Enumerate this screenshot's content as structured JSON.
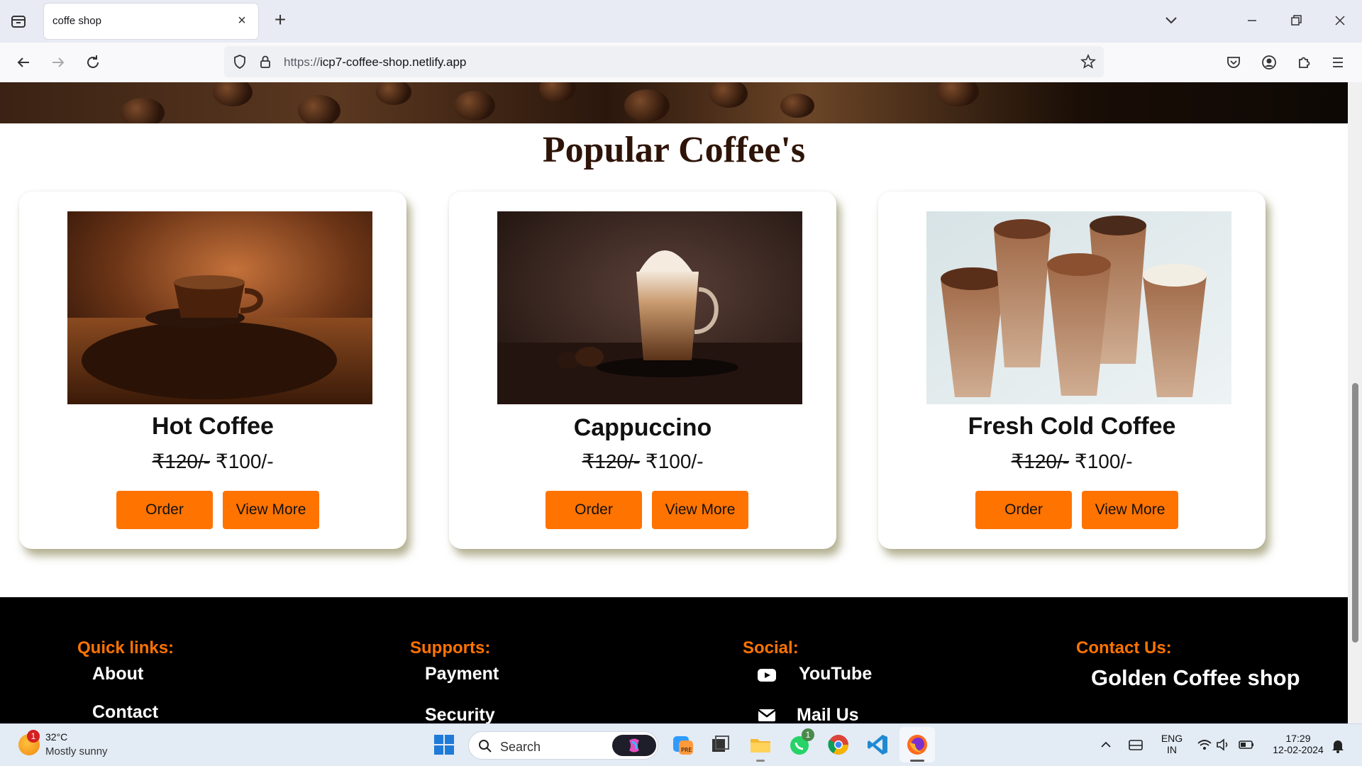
{
  "browser": {
    "tab_title": "coffe shop",
    "url_protocol": "https://",
    "url_host": "icp7-coffee-shop.netlify.app"
  },
  "page": {
    "section_title": "Popular Coffee's",
    "cards": [
      {
        "name": "Hot Coffee",
        "old_price": "₹120/-",
        "price": "₹100/-",
        "order_label": "Order",
        "more_label": "View More"
      },
      {
        "name": "Cappuccino",
        "old_price": "₹120/-",
        "price": "₹100/-",
        "order_label": "Order",
        "more_label": "View More"
      },
      {
        "name": "Fresh Cold Coffee",
        "old_price": "₹120/-",
        "price": "₹100/-",
        "order_label": "Order",
        "more_label": "View More"
      }
    ],
    "accent_color": "#ff7300"
  },
  "footer": {
    "quick_links": {
      "heading": "Quick links:",
      "items": [
        "About",
        "Contact"
      ]
    },
    "supports": {
      "heading": "Supports:",
      "items": [
        "Payment",
        "Security"
      ]
    },
    "social": {
      "heading": "Social:",
      "items": [
        {
          "label": "YouTube",
          "icon": "youtube-icon"
        },
        {
          "label": "Mail Us",
          "icon": "mail-icon"
        }
      ]
    },
    "contact": {
      "heading": "Contact Us:",
      "brand": "Golden Coffee shop"
    }
  },
  "taskbar": {
    "weather_temp": "32°C",
    "weather_desc": "Mostly sunny",
    "weather_badge": "1",
    "search_placeholder": "Search",
    "whatsapp_badge": "1",
    "language_line1": "ENG",
    "language_line2": "IN",
    "time": "17:29",
    "date": "12-02-2024"
  }
}
